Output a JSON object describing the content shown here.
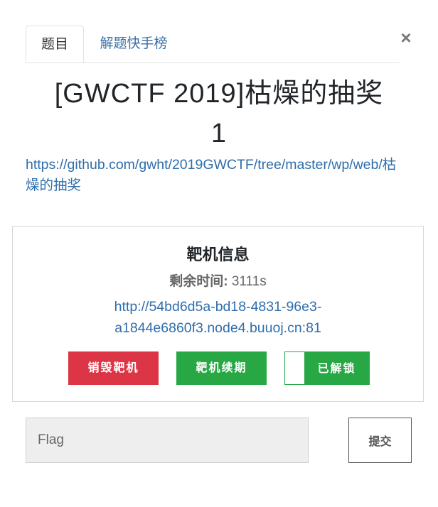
{
  "tabs": [
    {
      "label": "题目"
    },
    {
      "label": "解题快手榜"
    }
  ],
  "close_label": "×",
  "challenge": {
    "title": "[GWCTF 2019]枯燥的抽奖",
    "title_line2": "1",
    "description_link": "https://github.com/gwht/2019GWCTF/tree/master/wp/web/枯燥的抽奖"
  },
  "instance": {
    "heading": "靶机信息",
    "remaining_label": "剩余时间:",
    "remaining_value": "3111s",
    "url": "http://54bd6d5a-bd18-4831-96e3-a1844e6860f3.node4.buuoj.cn:81",
    "buttons": {
      "destroy": "销毁靶机",
      "renew": "靶机续期",
      "unlocked": "已解锁"
    }
  },
  "flag": {
    "placeholder": "Flag",
    "value": "",
    "submit_label": "提交"
  },
  "colors": {
    "link": "#2f6eab",
    "danger": "#dc3545",
    "success": "#28a745"
  }
}
